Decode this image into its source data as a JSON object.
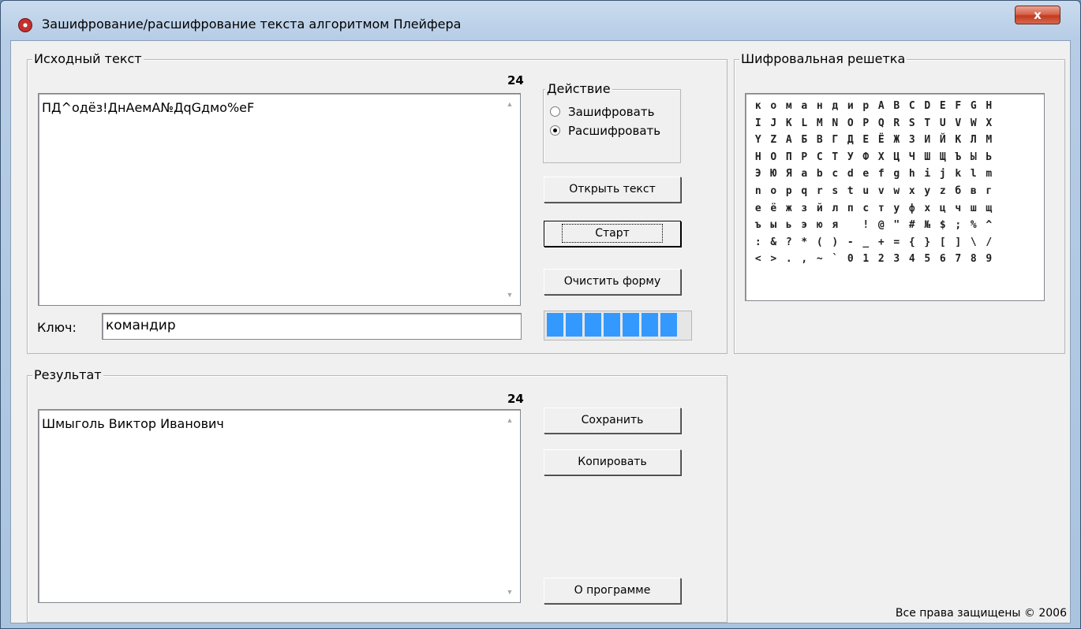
{
  "window": {
    "title": "Зашифрование/расшифрование текста алгоритмом Плейфера",
    "close_label": "x"
  },
  "source": {
    "group_title": "Исходный текст",
    "counter": "24",
    "text": "ПД^одёз!ДнАемА№ДqGдмо%eF",
    "key_label": "Ключ:",
    "key_value": "командир"
  },
  "action": {
    "group_title": "Действие",
    "options": [
      {
        "label": "Зашифровать",
        "selected": false
      },
      {
        "label": "Расшифровать",
        "selected": true
      }
    ],
    "open_label": "Открыть текст",
    "start_label": "Старт",
    "clear_label": "Очистить форму",
    "progress": 1.0
  },
  "result": {
    "group_title": "Результат",
    "counter": "24",
    "text": "Шмыголь Виктор Иванович",
    "save_label": "Сохранить",
    "copy_label": "Копировать",
    "about_label": "О программе"
  },
  "grid": {
    "group_title": "Шифровальная решетка",
    "rows": [
      [
        "к",
        "о",
        "м",
        "а",
        "н",
        "д",
        "и",
        "р",
        "A",
        "B",
        "C",
        "D",
        "E",
        "F",
        "G",
        "H"
      ],
      [
        "I",
        "J",
        "K",
        "L",
        "M",
        "N",
        "O",
        "P",
        "Q",
        "R",
        "S",
        "T",
        "U",
        "V",
        "W",
        "X"
      ],
      [
        "Y",
        "Z",
        "А",
        "Б",
        "В",
        "Г",
        "Д",
        "Е",
        "Ё",
        "Ж",
        "З",
        "И",
        "Й",
        "К",
        "Л",
        "М"
      ],
      [
        "Н",
        "О",
        "П",
        "Р",
        "С",
        "Т",
        "У",
        "Ф",
        "Х",
        "Ц",
        "Ч",
        "Ш",
        "Щ",
        "Ъ",
        "Ы",
        "Ь"
      ],
      [
        "Э",
        "Ю",
        "Я",
        "a",
        "b",
        "c",
        "d",
        "e",
        "f",
        "g",
        "h",
        "i",
        "j",
        "k",
        "l",
        "m"
      ],
      [
        "n",
        "o",
        "p",
        "q",
        "r",
        "s",
        "t",
        "u",
        "v",
        "w",
        "x",
        "y",
        "z",
        "б",
        "в",
        "г"
      ],
      [
        "е",
        "ё",
        "ж",
        "з",
        "й",
        "л",
        "п",
        "с",
        "т",
        "у",
        "ф",
        "х",
        "ц",
        "ч",
        "ш",
        "щ"
      ],
      [
        "ъ",
        "ы",
        "ь",
        "э",
        "ю",
        "я",
        " ",
        "!",
        "@",
        "\"",
        "#",
        "№",
        "$",
        ";",
        "%",
        "^"
      ],
      [
        ":",
        "&",
        "?",
        "*",
        "(",
        ")",
        "-",
        "_",
        "+",
        "=",
        "{",
        "}",
        "[",
        "]",
        "\\",
        "/"
      ],
      [
        "<",
        ">",
        ".",
        ",",
        "~",
        "`",
        "0",
        "1",
        "2",
        "3",
        "4",
        "5",
        "6",
        "7",
        "8",
        "9"
      ]
    ]
  },
  "footer": {
    "copyright": "Все права защищены © 2006"
  }
}
